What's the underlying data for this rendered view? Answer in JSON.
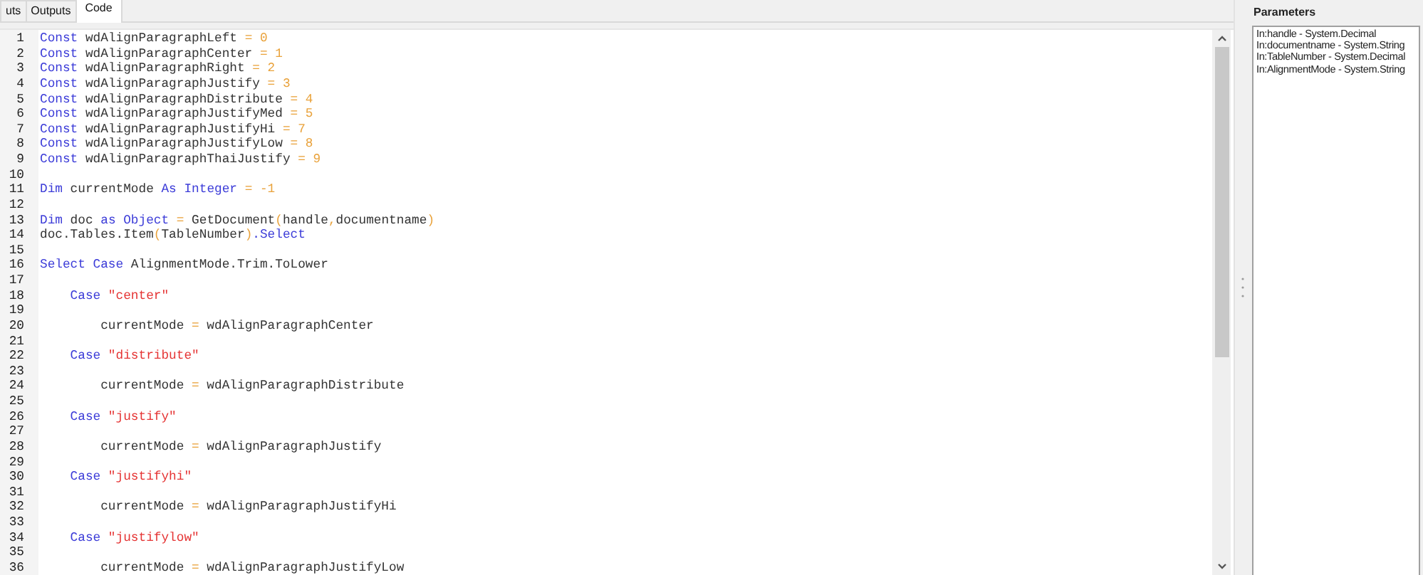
{
  "tabs": [
    {
      "label": "uts",
      "selected": false
    },
    {
      "label": "Outputs",
      "selected": false
    },
    {
      "label": "Code",
      "selected": true
    }
  ],
  "code": {
    "lines": [
      {
        "number": "1",
        "tokens": [
          {
            "kind": "keyword",
            "text": "Const"
          },
          {
            "kind": "plain",
            "text": " wdAlignParagraphLeft "
          },
          {
            "kind": "operator",
            "text": "= 0"
          }
        ]
      },
      {
        "number": "2",
        "tokens": [
          {
            "kind": "keyword",
            "text": "Const"
          },
          {
            "kind": "plain",
            "text": " wdAlignParagraphCenter "
          },
          {
            "kind": "operator",
            "text": "= 1"
          }
        ]
      },
      {
        "number": "3",
        "tokens": [
          {
            "kind": "keyword",
            "text": "Const"
          },
          {
            "kind": "plain",
            "text": " wdAlignParagraphRight "
          },
          {
            "kind": "operator",
            "text": "= 2"
          }
        ]
      },
      {
        "number": "4",
        "tokens": [
          {
            "kind": "keyword",
            "text": "Const"
          },
          {
            "kind": "plain",
            "text": " wdAlignParagraphJustify "
          },
          {
            "kind": "operator",
            "text": "= 3"
          }
        ]
      },
      {
        "number": "5",
        "tokens": [
          {
            "kind": "keyword",
            "text": "Const"
          },
          {
            "kind": "plain",
            "text": " wdAlignParagraphDistribute "
          },
          {
            "kind": "operator",
            "text": "= 4"
          }
        ]
      },
      {
        "number": "6",
        "tokens": [
          {
            "kind": "keyword",
            "text": "Const"
          },
          {
            "kind": "plain",
            "text": " wdAlignParagraphJustifyMed "
          },
          {
            "kind": "operator",
            "text": "= 5"
          }
        ]
      },
      {
        "number": "7",
        "tokens": [
          {
            "kind": "keyword",
            "text": "Const"
          },
          {
            "kind": "plain",
            "text": " wdAlignParagraphJustifyHi "
          },
          {
            "kind": "operator",
            "text": "= 7"
          }
        ]
      },
      {
        "number": "8",
        "tokens": [
          {
            "kind": "keyword",
            "text": "Const"
          },
          {
            "kind": "plain",
            "text": " wdAlignParagraphJustifyLow "
          },
          {
            "kind": "operator",
            "text": "= 8"
          }
        ]
      },
      {
        "number": "9",
        "tokens": [
          {
            "kind": "keyword",
            "text": "Const"
          },
          {
            "kind": "plain",
            "text": " wdAlignParagraphThaiJustify "
          },
          {
            "kind": "operator",
            "text": "= 9"
          }
        ]
      },
      {
        "number": "10"
      },
      {
        "number": "11",
        "tokens": [
          {
            "kind": "keyword",
            "text": "Dim"
          },
          {
            "kind": "plain",
            "text": " currentMode "
          },
          {
            "kind": "keyword",
            "text": "As Integer "
          },
          {
            "kind": "operator",
            "text": "= -1"
          }
        ]
      },
      {
        "number": "12"
      },
      {
        "number": "13",
        "tokens": [
          {
            "kind": "keyword",
            "text": "Dim"
          },
          {
            "kind": "plain",
            "text": " doc "
          },
          {
            "kind": "keyword",
            "text": "as Object "
          },
          {
            "kind": "operator",
            "text": "="
          },
          {
            "kind": "plain",
            "text": " GetDocument"
          },
          {
            "kind": "operator",
            "text": "("
          },
          {
            "kind": "plain",
            "text": "handle"
          },
          {
            "kind": "operator",
            "text": ","
          },
          {
            "kind": "plain",
            "text": "documentname"
          },
          {
            "kind": "operator",
            "text": ")"
          }
        ]
      },
      {
        "number": "14",
        "tokens": [
          {
            "kind": "plain",
            "text": "doc.Tables.Item"
          },
          {
            "kind": "operator",
            "text": "("
          },
          {
            "kind": "plain",
            "text": "TableNumber"
          },
          {
            "kind": "operator",
            "text": ")"
          },
          {
            "kind": "keyword",
            "text": ".Select"
          }
        ]
      },
      {
        "number": "15"
      },
      {
        "number": "16",
        "tokens": [
          {
            "kind": "keyword",
            "text": "Select Case"
          },
          {
            "kind": "plain",
            "text": " AlignmentMode.Trim.ToLower"
          }
        ]
      },
      {
        "number": "17"
      },
      {
        "number": "18",
        "tokens": [
          {
            "kind": "keyword",
            "text": "    Case"
          },
          {
            "kind": "string",
            "text": " \"center\""
          }
        ]
      },
      {
        "number": "19"
      },
      {
        "number": "20",
        "tokens": [
          {
            "kind": "plain",
            "text": "        currentMode "
          },
          {
            "kind": "operator",
            "text": "="
          },
          {
            "kind": "plain",
            "text": " wdAlignParagraphCenter"
          }
        ]
      },
      {
        "number": "21"
      },
      {
        "number": "22",
        "tokens": [
          {
            "kind": "keyword",
            "text": "    Case"
          },
          {
            "kind": "string",
            "text": " \"distribute\""
          }
        ]
      },
      {
        "number": "23"
      },
      {
        "number": "24",
        "tokens": [
          {
            "kind": "plain",
            "text": "        currentMode "
          },
          {
            "kind": "operator",
            "text": "="
          },
          {
            "kind": "plain",
            "text": " wdAlignParagraphDistribute"
          }
        ]
      },
      {
        "number": "25"
      },
      {
        "number": "26",
        "tokens": [
          {
            "kind": "keyword",
            "text": "    Case"
          },
          {
            "kind": "string",
            "text": " \"justify\""
          }
        ]
      },
      {
        "number": "27"
      },
      {
        "number": "28",
        "tokens": [
          {
            "kind": "plain",
            "text": "        currentMode "
          },
          {
            "kind": "operator",
            "text": "="
          },
          {
            "kind": "plain",
            "text": " wdAlignParagraphJustify"
          }
        ]
      },
      {
        "number": "29"
      },
      {
        "number": "30",
        "tokens": [
          {
            "kind": "keyword",
            "text": "    Case"
          },
          {
            "kind": "string",
            "text": " \"justifyhi\""
          }
        ]
      },
      {
        "number": "31"
      },
      {
        "number": "32",
        "tokens": [
          {
            "kind": "plain",
            "text": "        currentMode "
          },
          {
            "kind": "operator",
            "text": "="
          },
          {
            "kind": "plain",
            "text": " wdAlignParagraphJustifyHi"
          }
        ]
      },
      {
        "number": "33"
      },
      {
        "number": "34",
        "tokens": [
          {
            "kind": "keyword",
            "text": "    Case"
          },
          {
            "kind": "string",
            "text": " \"justifylow\""
          }
        ]
      },
      {
        "number": "35"
      },
      {
        "number": "36",
        "tokens": [
          {
            "kind": "plain",
            "text": "        currentMode "
          },
          {
            "kind": "operator",
            "text": "="
          },
          {
            "kind": "plain",
            "text": " wdAlignParagraphJustifyLow"
          }
        ]
      }
    ]
  },
  "parameters": {
    "title": "Parameters",
    "items": [
      "In:handle - System.Decimal",
      "In:documentname - System.String",
      "In:TableNumber - System.Decimal",
      "In:AlignmentMode - System.String"
    ]
  }
}
